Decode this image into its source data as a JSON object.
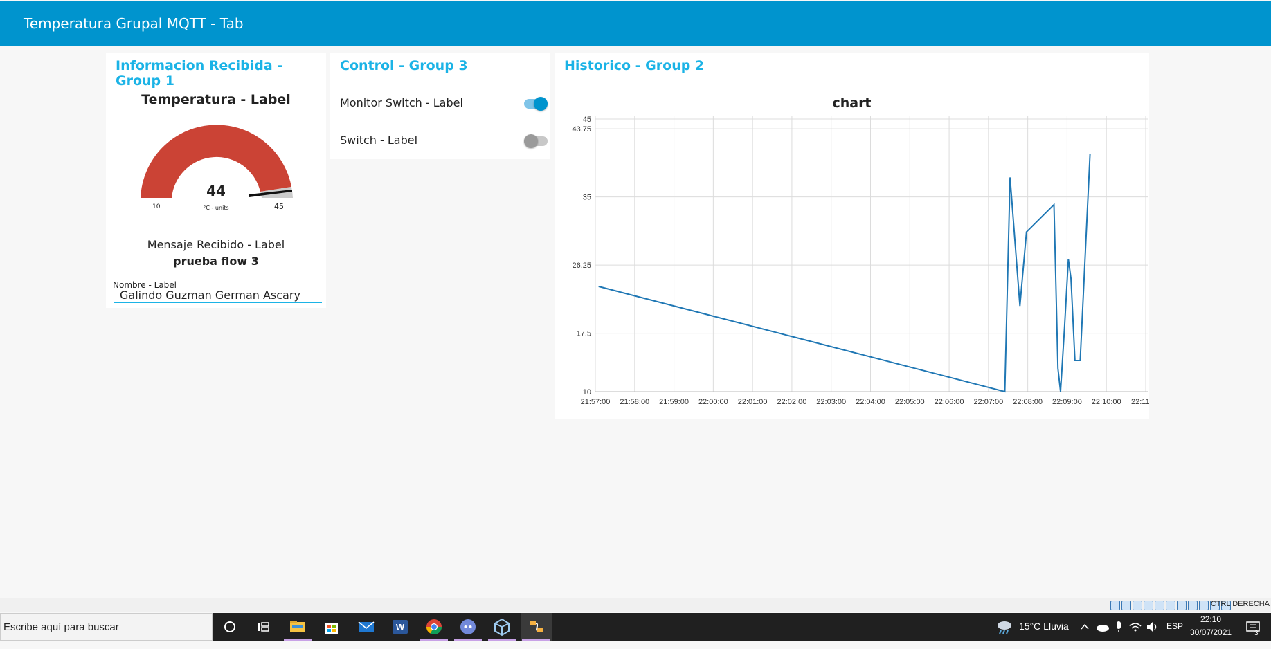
{
  "header": {
    "title": "Temperatura Grupal MQTT - Tab"
  },
  "group1": {
    "title": "Informacion Recibida - Group 1",
    "gauge": {
      "label": "Temperatura - Label",
      "value": "44",
      "units": "°C - units",
      "min": "10",
      "max": "45",
      "fill_color": "#cb4335"
    },
    "message": {
      "label": "Mensaje Recibido - Label",
      "value": "prueba flow 3"
    },
    "name_field": {
      "label": "Nombre - Label",
      "value": "Galindo Guzman German Ascary"
    }
  },
  "group3": {
    "title": "Control - Group 3",
    "switches": [
      {
        "label": "Monitor Switch - Label",
        "on": true
      },
      {
        "label": "Switch - Label",
        "on": false
      }
    ]
  },
  "group2": {
    "title": "Historico - Group 2"
  },
  "chart_data": {
    "type": "line",
    "title": "chart",
    "xlabel": "",
    "ylabel": "",
    "ylim": [
      10,
      45
    ],
    "yticks": [
      "45",
      "43.75",
      "35",
      "26.25",
      "17.5",
      "10"
    ],
    "xticks": [
      "21:57:00",
      "21:58:00",
      "21:59:00",
      "22:00:00",
      "22:01:00",
      "22:02:00",
      "22:03:00",
      "22:04:00",
      "22:05:00",
      "22:06:00",
      "22:07:00",
      "22:08:00",
      "22:09:00",
      "22:10:00",
      "22:11:00"
    ],
    "series": [
      {
        "color": "#1f77b4",
        "points": [
          [
            "21:57:05",
            23.5
          ],
          [
            "22:07:25",
            10.0
          ],
          [
            "22:07:33",
            37.5
          ],
          [
            "22:07:48",
            21.0
          ],
          [
            "22:07:58",
            30.5
          ],
          [
            "22:08:40",
            34.0
          ],
          [
            "22:08:46",
            13.0
          ],
          [
            "22:08:50",
            10.0
          ],
          [
            "22:08:56",
            18.0
          ],
          [
            "22:09:02",
            27.0
          ],
          [
            "22:09:06",
            24.5
          ],
          [
            "22:09:12",
            14.0
          ],
          [
            "22:09:20",
            14.0
          ],
          [
            "22:09:35",
            40.5
          ]
        ]
      }
    ]
  },
  "statusbar": {
    "text": "CTRL DERECHA"
  },
  "taskbar": {
    "search_placeholder": "Escribe aquí para buscar",
    "weather": "15°C  Lluvia",
    "language": "ESP",
    "time": "22:10",
    "date": "30/07/2021",
    "notifications": "3"
  }
}
